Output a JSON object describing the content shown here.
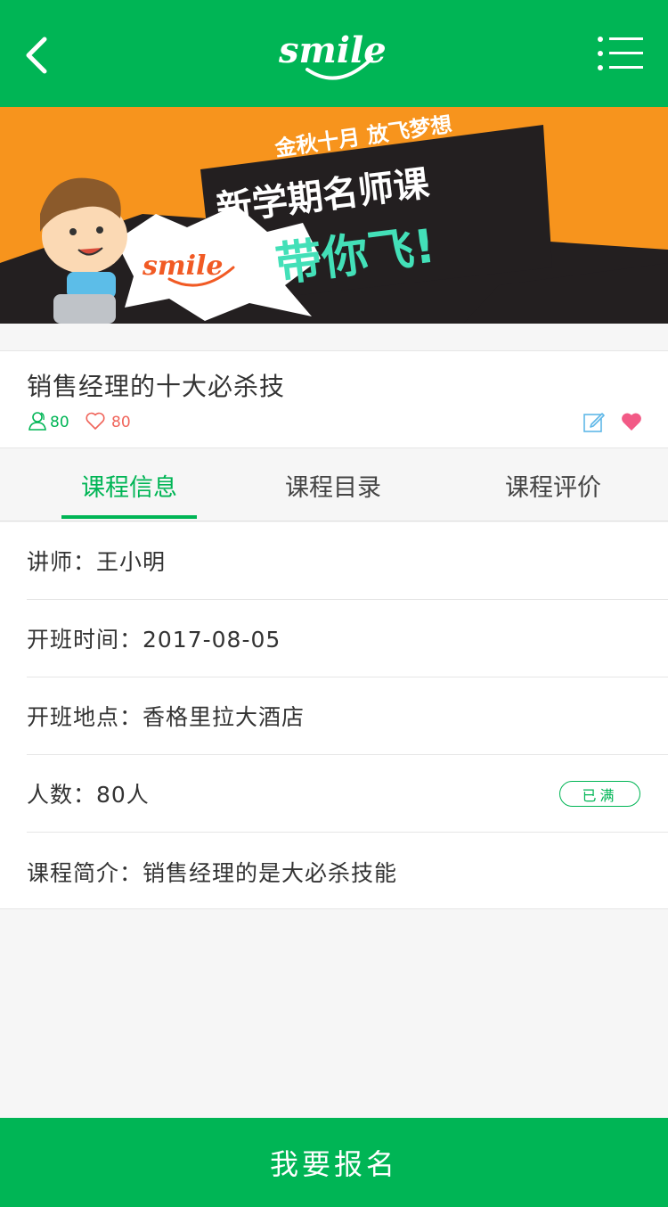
{
  "header": {
    "logo_text": "smile",
    "back_icon": "chevron-left-icon",
    "menu_icon": "list-menu-icon"
  },
  "banner": {
    "line1": "金秋十月 放飞梦想",
    "line2": "新学期名师课",
    "line3": "带你飞!",
    "logo_text": "smile"
  },
  "course": {
    "title": "销售经理的十大必杀技",
    "students": "80",
    "likes": "80"
  },
  "tabs": [
    {
      "label": "课程信息"
    },
    {
      "label": "课程目录"
    },
    {
      "label": "课程评价"
    }
  ],
  "info": {
    "teacher": "讲师：王小明",
    "start_time": "开班时间：2017-08-05",
    "location": "开班地点：香格里拉大酒店",
    "capacity": "人数：80人",
    "status": "已满",
    "intro": "课程简介：销售经理的是大必杀技能"
  },
  "footer": {
    "signup_label": "我要报名"
  },
  "colors": {
    "primary": "#00b555",
    "banner_bg": "#f7941d",
    "like_red": "#f0645a",
    "heart_pink": "#f25a86",
    "edit_blue": "#5fb8e8"
  }
}
